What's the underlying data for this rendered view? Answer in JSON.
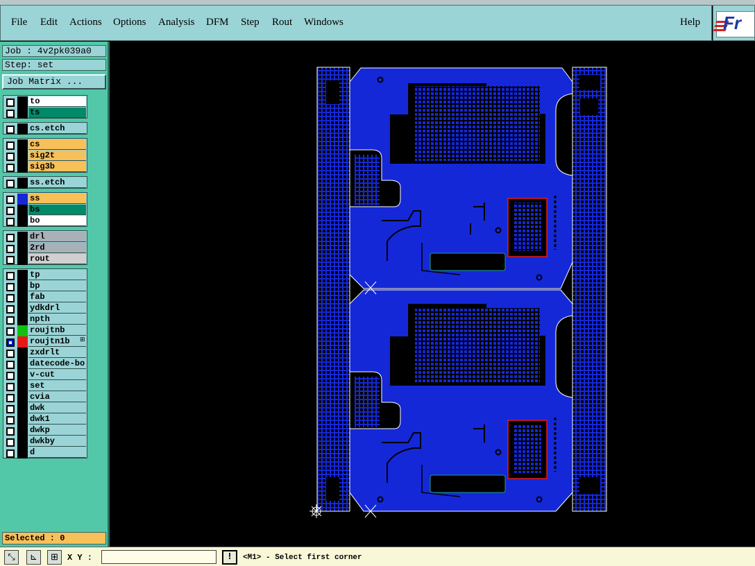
{
  "menu": {
    "file": "File",
    "edit": "Edit",
    "actions": "Actions",
    "options": "Options",
    "analysis": "Analysis",
    "dfm": "DFM",
    "step": "Step",
    "rout": "Rout",
    "windows": "Windows",
    "help": "Help"
  },
  "logo_text": "Fr",
  "job_label": "Job : 4v2pk039a0",
  "step_label": "Step: set",
  "job_matrix_button": "Job Matrix ...",
  "layers": [
    {
      "name": "to",
      "swatch": "#000000",
      "bg": "#ffffff",
      "selected": false
    },
    {
      "name": "ts",
      "swatch": "#000000",
      "bg": "#008a68",
      "selected": false
    },
    {
      "name": "cs.etch",
      "swatch": "#000000",
      "bg": "#9ad4d6",
      "selected": false
    },
    {
      "name": "cs",
      "swatch": "#000000",
      "bg": "#f8c058",
      "selected": false
    },
    {
      "name": "sig2t",
      "swatch": "#000000",
      "bg": "#f8c058",
      "selected": false
    },
    {
      "name": "sig3b",
      "swatch": "#000000",
      "bg": "#f8c058",
      "selected": false
    },
    {
      "name": "ss.etch",
      "swatch": "#000000",
      "bg": "#9ad4d6",
      "selected": false
    },
    {
      "name": "ss",
      "swatch": "#1428d8",
      "bg": "#f8c058",
      "selected": false
    },
    {
      "name": "bs",
      "swatch": "#000000",
      "bg": "#008a68",
      "selected": false
    },
    {
      "name": "bo",
      "swatch": "#000000",
      "bg": "#ffffff",
      "selected": false
    },
    {
      "name": "drl",
      "swatch": "#000000",
      "bg": "#a8b0b8",
      "selected": false
    },
    {
      "name": "2rd",
      "swatch": "#000000",
      "bg": "#a8b0b8",
      "selected": false
    },
    {
      "name": "rout",
      "swatch": "#000000",
      "bg": "#d0d0d0",
      "selected": false
    },
    {
      "name": "tp",
      "swatch": "#000000",
      "bg": "#9ad4d6",
      "selected": false
    },
    {
      "name": "bp",
      "swatch": "#000000",
      "bg": "#9ad4d6",
      "selected": false
    },
    {
      "name": "fab",
      "swatch": "#000000",
      "bg": "#9ad4d6",
      "selected": false
    },
    {
      "name": "ydkdrl",
      "swatch": "#000000",
      "bg": "#9ad4d6",
      "selected": false
    },
    {
      "name": "npth",
      "swatch": "#000000",
      "bg": "#9ad4d6",
      "selected": false
    },
    {
      "name": "roujtnb",
      "swatch": "#10c010",
      "bg": "#9ad4d6",
      "selected": false
    },
    {
      "name": "roujtn1b",
      "swatch": "#e81818",
      "bg": "#9ad4d6",
      "selected": true,
      "extra": "⊞"
    },
    {
      "name": "zxdrlt",
      "swatch": "#000000",
      "bg": "#9ad4d6",
      "selected": false
    },
    {
      "name": "datecode-bo",
      "swatch": "#000000",
      "bg": "#9ad4d6",
      "selected": false
    },
    {
      "name": "v-cut",
      "swatch": "#000000",
      "bg": "#9ad4d6",
      "selected": false
    },
    {
      "name": "set",
      "swatch": "#000000",
      "bg": "#9ad4d6",
      "selected": false
    },
    {
      "name": "cvia",
      "swatch": "#000000",
      "bg": "#9ad4d6",
      "selected": false
    },
    {
      "name": "dwk",
      "swatch": "#000000",
      "bg": "#9ad4d6",
      "selected": false
    },
    {
      "name": "dwk1",
      "swatch": "#000000",
      "bg": "#9ad4d6",
      "selected": false
    },
    {
      "name": "dwkp",
      "swatch": "#000000",
      "bg": "#9ad4d6",
      "selected": false
    },
    {
      "name": "dwkby",
      "swatch": "#000000",
      "bg": "#9ad4d6",
      "selected": false
    },
    {
      "name": "d",
      "swatch": "#000000",
      "bg": "#9ad4d6",
      "selected": false
    }
  ],
  "selected_status": "Selected : 0",
  "bottom": {
    "xy_label": "X Y :",
    "xy_value": "",
    "alert_glyph": "!",
    "prompt": "<M1> - Select first corner"
  },
  "colors": {
    "board": "#1428d8",
    "rail": "#1428d8",
    "outline": "#ffffff",
    "highlight": "#e81818"
  }
}
